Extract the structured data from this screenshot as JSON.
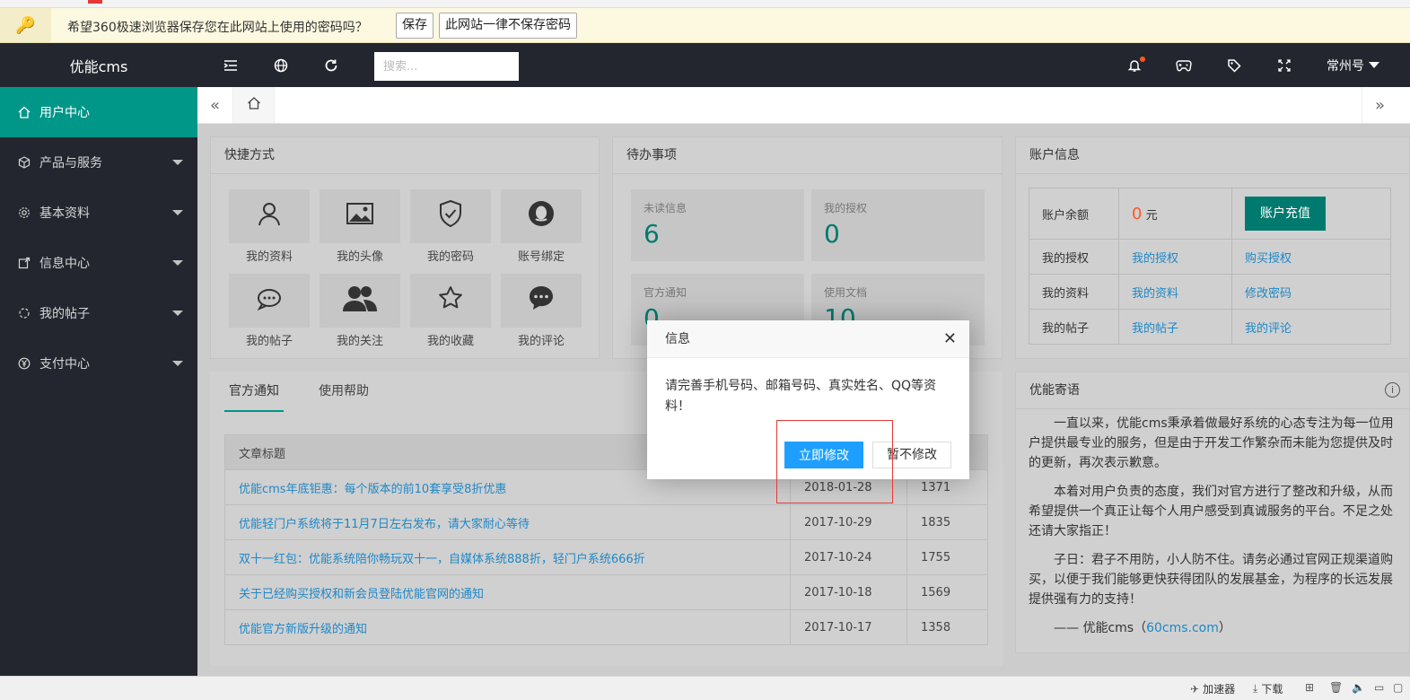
{
  "password_bar": {
    "message": "希望360极速浏览器保存您在此网站上使用的密码吗？",
    "save_label": "保存",
    "never_label": "此网站一律不保存密码"
  },
  "header": {
    "logo": "优能cms",
    "search_placeholder": "搜索...",
    "user_name": "常州号",
    "icons": [
      "menu-icon",
      "globe-icon",
      "refresh-icon",
      "bell-icon",
      "gamepad-icon",
      "tag-icon",
      "fullscreen-icon"
    ]
  },
  "sidebar": {
    "items": [
      {
        "label": "用户中心",
        "icon": "home-icon",
        "active": true
      },
      {
        "label": "产品与服务",
        "icon": "box-icon"
      },
      {
        "label": "基本资料",
        "icon": "gear-icon"
      },
      {
        "label": "信息中心",
        "icon": "message-icon"
      },
      {
        "label": "我的帖子",
        "icon": "post-icon"
      },
      {
        "label": "支付中心",
        "icon": "yen-icon"
      }
    ]
  },
  "shortcuts": {
    "title": "快捷方式",
    "items": [
      {
        "label": "我的资料",
        "icon": "user-icon"
      },
      {
        "label": "我的头像",
        "icon": "image-icon"
      },
      {
        "label": "我的密码",
        "icon": "shield-check-icon"
      },
      {
        "label": "账号绑定",
        "icon": "qq-icon"
      },
      {
        "label": "我的帖子",
        "icon": "chat-bubbles-icon"
      },
      {
        "label": "我的关注",
        "icon": "users-icon"
      },
      {
        "label": "我的收藏",
        "icon": "star-icon"
      },
      {
        "label": "我的评论",
        "icon": "comment-icon"
      }
    ]
  },
  "todo": {
    "title": "待办事项",
    "items": [
      {
        "label": "未读信息",
        "value": "6"
      },
      {
        "label": "我的授权",
        "value": "0"
      },
      {
        "label": "官方通知",
        "value": "0"
      },
      {
        "label": "使用文档",
        "value": "10"
      }
    ]
  },
  "account": {
    "title": "账户信息",
    "balance_label": "账户余额",
    "balance_value": "0",
    "balance_unit": "元",
    "recharge_label": "账户充值",
    "rows": [
      {
        "label": "我的授权",
        "link1": "我的授权",
        "link2": "购买授权"
      },
      {
        "label": "我的资料",
        "link1": "我的资料",
        "link2": "修改密码"
      },
      {
        "label": "我的帖子",
        "link1": "我的帖子",
        "link2": "我的评论"
      }
    ]
  },
  "news": {
    "tabs": [
      "官方通知",
      "使用帮助"
    ],
    "column_title": "文章标题",
    "rows": [
      {
        "title": "优能cms年底钜惠：每个版本的前10套享受8折优惠",
        "date": "2018-01-28",
        "views": "1371"
      },
      {
        "title": "优能轻门户系统将于11月7日左右发布，请大家耐心等待",
        "date": "2017-10-29",
        "views": "1835"
      },
      {
        "title": "双十一红包：优能系统陪你畅玩双十一，自媒体系统888折，轻门户系统666折",
        "date": "2017-10-24",
        "views": "1755"
      },
      {
        "title": "关于已经购买授权和新会员登陆优能官网的通知",
        "date": "2017-10-18",
        "views": "1569"
      },
      {
        "title": "优能官方新版升级的通知",
        "date": "2017-10-17",
        "views": "1358"
      }
    ]
  },
  "motto": {
    "title": "优能寄语",
    "p1": "一直以来，优能cms秉承着做最好系统的心态专注为每一位用户提供最专业的服务，但是由于开发工作繁杂而未能为您提供及时的更新，再次表示歉意。",
    "p2": "本着对用户负责的态度，我们对官方进行了整改和升级，从而希望提供一个真正让每个人用户感受到真诚服务的平台。不足之处还请大家指正！",
    "p3": "子日：君子不用防，小人防不住。请务必通过官网正规渠道购买，以便于我们能够更快获得团队的发展基金，为程序的长远发展提供强有力的支持！",
    "sign_prefix": "—— 优能cms（",
    "sign_link": "60cms.com",
    "sign_suffix": "）"
  },
  "dialog": {
    "title": "信息",
    "body": "请完善手机号码、邮箱号码、真实姓名、QQ等资料！",
    "confirm_label": "立即修改",
    "cancel_label": "暂不修改"
  },
  "statusbar": {
    "accelerator": "加速器",
    "download": "下载"
  }
}
